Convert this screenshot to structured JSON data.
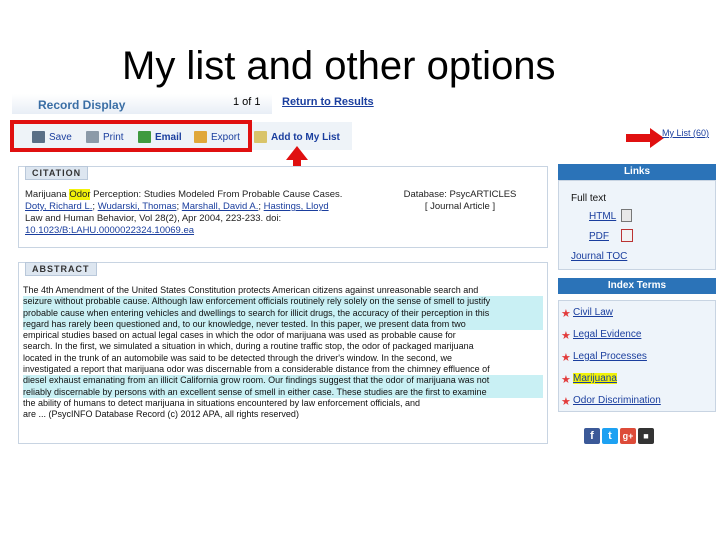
{
  "slide": {
    "title": "My list and other options"
  },
  "header": {
    "record_display": "Record Display",
    "page_count": "1 of 1",
    "return_link": "Return to Results"
  },
  "toolbar": {
    "save": "Save",
    "print": "Print",
    "email": "Email",
    "export": "Export",
    "add_to_list": "Add to My List"
  },
  "my_list": "My List (60)",
  "citation": {
    "tab": "CITATION",
    "title_pre": "Marijuana ",
    "title_hl": "Odor",
    "title_post": " Perception: Studies Modeled From Probable Cause Cases.",
    "authors": [
      "Doty, Richard L.",
      "Wudarski, Thomas",
      "Marshall, David A.",
      "Hastings, Lloyd"
    ],
    "journal": "Law and Human Behavior, Vol 28(2), Apr 2004, 223-233. doi:",
    "doi": "10.1023/B:LAHU.0000022324.10069.ea",
    "database": "Database: PsycARTICLES",
    "type": "[ Journal Article ]"
  },
  "abstract": {
    "tab": "ABSTRACT",
    "lines": [
      "The 4th Amendment of the United States Constitution protects American citizens against unreasonable search and",
      "seizure without probable cause. Although law enforcement officials routinely rely solely on the sense of smell to justify",
      "probable cause when entering vehicles and dwellings to search for illicit drugs, the accuracy of their perception in this",
      "regard has rarely been questioned and, to our knowledge, never tested. In this paper, we present data from two",
      "empirical studies based on actual legal cases in which the odor of marijuana was used as probable cause for",
      "search. In the first, we simulated a situation in which, during a routine traffic stop, the odor of packaged marijuana",
      "located in the trunk of an automobile was said to be detected through the driver's window. In the second, we",
      "investigated a report that marijuana odor was discernable from a considerable distance from the chimney effluence of",
      "diesel exhaust emanating from an illicit California grow room. Our findings suggest that the odor of marijuana was not",
      "reliably discernable by persons with an excellent sense of smell in either case. These studies are the first to examine",
      "the ability of humans to detect marijuana in situations encountered by law enforcement officials, and",
      "are ... (PsycINFO Database Record (c) 2012 APA, all rights reserved)"
    ]
  },
  "links": {
    "header": "Links",
    "full_text": "Full text",
    "html": "HTML",
    "pdf": "PDF",
    "journal_toc": "Journal TOC"
  },
  "index_terms": {
    "header": "Index Terms",
    "items": [
      "Civil Law",
      "Legal Evidence",
      "Legal Processes",
      "Marijuana",
      "Odor Discrimination"
    ]
  },
  "colors": {
    "highlight_yellow": "#f2f20a",
    "highlight_cyan": "#c9f0f4",
    "link_blue": "#1a3e9e",
    "annotation_red": "#e01010",
    "side_header_blue": "#2b73b8"
  }
}
